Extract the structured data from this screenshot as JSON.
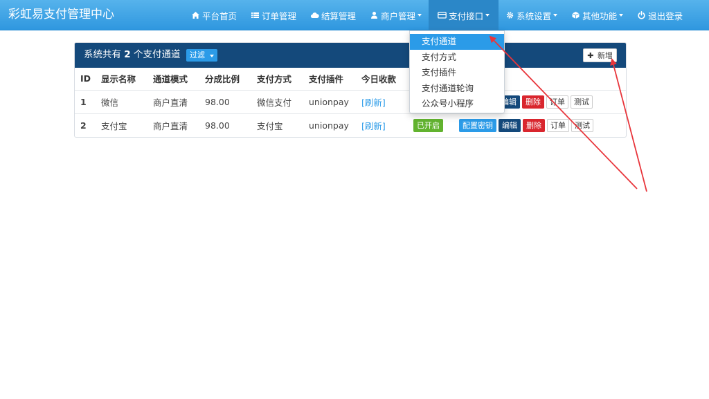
{
  "brand": "彩虹易支付管理中心",
  "nav": [
    {
      "label": "平台首页",
      "icon": "home-icon"
    },
    {
      "label": "订单管理",
      "icon": "list-icon"
    },
    {
      "label": "结算管理",
      "icon": "cloud-icon"
    },
    {
      "label": "商户管理",
      "icon": "user-icon"
    },
    {
      "label": "支付接口",
      "icon": "credit-card-icon"
    },
    {
      "label": "系统设置",
      "icon": "gear-icon"
    },
    {
      "label": "其他功能",
      "icon": "cube-icon"
    },
    {
      "label": "退出登录",
      "icon": "power-icon"
    }
  ],
  "panel": {
    "title_prefix": "系统共有",
    "count": "2",
    "title_suffix": "个支付通道",
    "filter_label": "过滤",
    "add_label": "新增"
  },
  "table": {
    "headers": [
      "ID",
      "显示名称",
      "通道模式",
      "分成比例",
      "支付方式",
      "支付插件",
      "今日收款"
    ],
    "rows": [
      {
        "id": "1",
        "name": "微信",
        "mode": "商户直清",
        "rate": "98.00",
        "type": "微信支付",
        "plugin": "unionpay",
        "today": "[刷新]",
        "status": "",
        "key": "",
        "edit": "编辑",
        "del": "删除",
        "order": "订单",
        "test": "测试"
      },
      {
        "id": "2",
        "name": "支付宝",
        "mode": "商户直清",
        "rate": "98.00",
        "type": "支付宝",
        "plugin": "unionpay",
        "today": "[刷新]",
        "status": "已开启",
        "key": "配置密钥",
        "edit": "编辑",
        "del": "删除",
        "order": "订单",
        "test": "测试"
      }
    ]
  },
  "dropdown": [
    "支付通道",
    "支付方式",
    "支付插件",
    "支付通道轮询",
    "公众号小程序"
  ],
  "colors": {
    "nav_bg": "#3fa6e6",
    "panel_heading": "#14497b",
    "primary": "#2b9be8",
    "danger": "#d9262e",
    "success": "#62b32f",
    "annotation": "#e8353b"
  }
}
